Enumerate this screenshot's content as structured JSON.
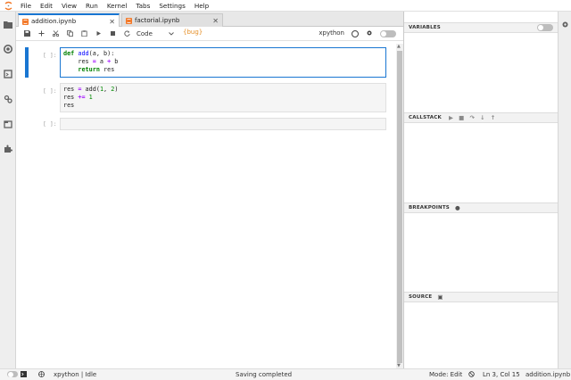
{
  "menu": {
    "items": [
      "File",
      "Edit",
      "View",
      "Run",
      "Kernel",
      "Tabs",
      "Settings",
      "Help"
    ]
  },
  "tabs": [
    {
      "label": "addition.ipynb",
      "active": true
    },
    {
      "label": "factorial.ipynb",
      "active": false
    }
  ],
  "toolbar": {
    "cell_type": "Code",
    "kernel_name": "xpython",
    "debug_icon": "{bug}"
  },
  "cells": [
    {
      "prompt": "[ ]:",
      "lines": [
        "def add(a, b):",
        "    res = a + b",
        "    return res"
      ],
      "active": true
    },
    {
      "prompt": "[ ]:",
      "lines": [
        "res = add(1, 2)",
        "res += 1",
        "res"
      ],
      "active": false
    },
    {
      "prompt": "[ ]:",
      "lines": [
        ""
      ],
      "active": false
    }
  ],
  "debugger": {
    "variables": "VARIABLES",
    "callstack": "CALLSTACK",
    "breakpoints": "BREAKPOINTS",
    "source": "SOURCE"
  },
  "statusbar": {
    "kernel": "xpython | Idle",
    "saving": "Saving completed",
    "mode": "Mode: Edit",
    "position": "Ln 3, Col 15",
    "filename": "addition.ipynb"
  },
  "colors": {
    "accent": "#1976d2",
    "brand": "#f37726",
    "debug": "#e58e26"
  }
}
